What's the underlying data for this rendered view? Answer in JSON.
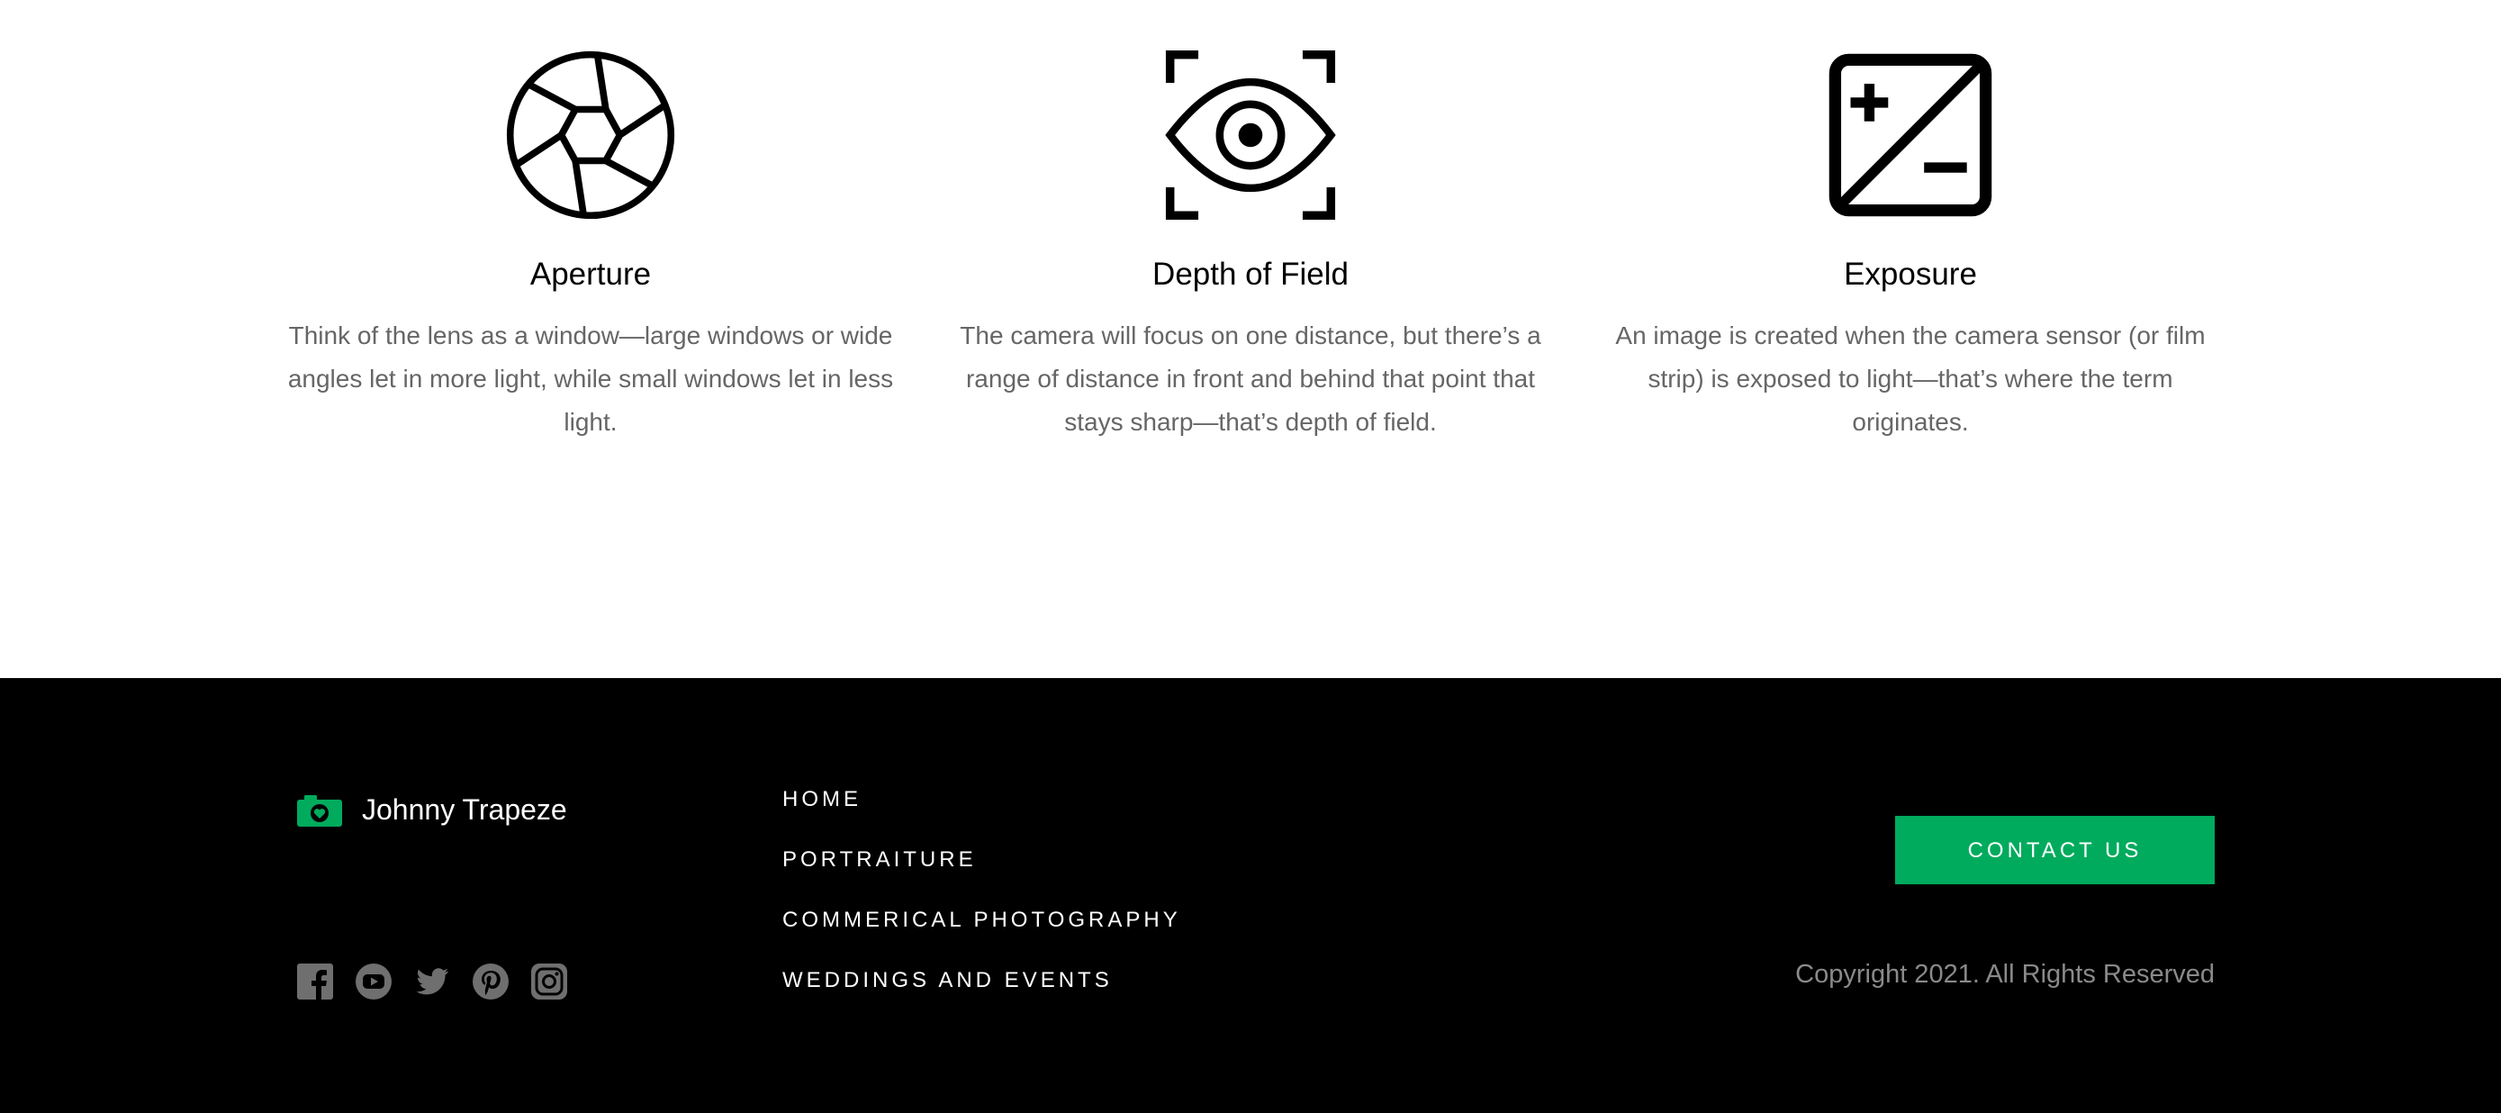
{
  "features": [
    {
      "icon": "aperture-icon",
      "title": "Aperture",
      "text": "Think of the lens as a window—large windows or wide angles let in more light, while small windows let in less light."
    },
    {
      "icon": "eye-focus-icon",
      "title": "Depth of Field",
      "text": "The camera will focus on one distance, but there’s a range of distance in front and behind that point that stays sharp—that’s depth of field."
    },
    {
      "icon": "exposure-icon",
      "title": "Exposure",
      "text": "An image is created when the camera sensor (or film strip) is exposed to light—that’s where the term originates."
    }
  ],
  "footer": {
    "brand_name": "Johnny Trapeze",
    "brand_icon": "camera-heart-icon",
    "social_icons": [
      "facebook-icon",
      "youtube-icon",
      "twitter-icon",
      "pinterest-icon",
      "instagram-icon"
    ],
    "nav": [
      "HOME",
      "PORTRAITURE",
      "COMMERICAL PHOTOGRAPHY",
      "WEDDINGS AND EVENTS"
    ],
    "contact_label": "CONTACT US",
    "copyright": "Copyright 2021. All Rights Reserved"
  },
  "colors": {
    "accent": "#00ab5d",
    "footer_bg": "#000000",
    "muted_text": "#666666"
  }
}
